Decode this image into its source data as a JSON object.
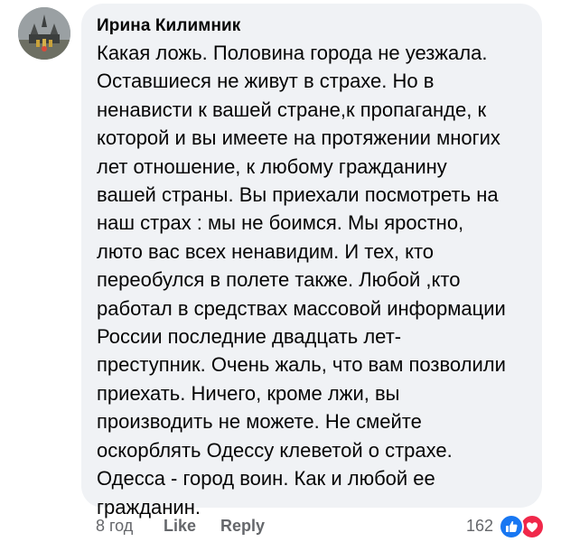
{
  "comment": {
    "author": "Ирина Килимник",
    "lines": [
      "Какая ложь. Половина города не уезжала.",
      "Оставшиеся не живут в страхе. Но в",
      "ненависти к вашей стране,к пропаганде, к",
      "которой и вы имеете на протяжении многих",
      "лет отношение,  к любому гражданину",
      "вашей страны. Вы приехали посмотреть на",
      "наш страх : мы не боимся. Мы яростно,",
      "люто вас всех ненавидим. И тех, кто",
      "переобулся в полете также. Любой ,кто",
      "работал в средствах массовой информации",
      "России последние двадцать лет-",
      "преступник. Очень жаль, что вам позволили",
      "приехать. Ничего, кроме лжи, вы",
      "производить не можете. Не смейте",
      "оскорблять Одессу клеветой о страхе.",
      "Одесса - город воин. Как и любой ее",
      "гражданин."
    ]
  },
  "footer": {
    "timestamp": "8 год",
    "like_label": "Like",
    "reply_label": "Reply",
    "reaction_count": "162",
    "reactions": [
      "like-icon",
      "love-icon"
    ]
  },
  "colors": {
    "bubble": "#f0f2f5",
    "text": "#050505",
    "meta": "#65676b",
    "like": "#1877f2",
    "love": "#f0284a"
  }
}
